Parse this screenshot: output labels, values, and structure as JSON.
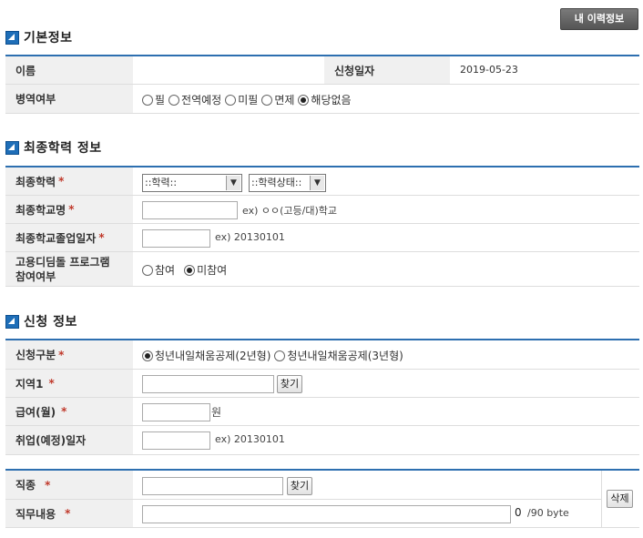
{
  "header": {
    "my_resume_button": "내 이력정보"
  },
  "sections": {
    "basic": {
      "title": "기본정보",
      "name_label": "이름",
      "name_value": "",
      "date_label": "신청일자",
      "date_value": "2019-05-23",
      "military_label": "병역여부",
      "military_options": [
        "필",
        "전역예정",
        "미필",
        "면제",
        "해당없음"
      ],
      "military_selected": "해당없음"
    },
    "education": {
      "title": "최종학력 정보",
      "degree_label": "최종학력",
      "degree_select": "::학력::",
      "status_select": "::학력상태::",
      "school_label": "최종학교명",
      "school_hint": "ex) ㅇㅇ(고등/대)학교",
      "grad_label": "최종학교졸업일자",
      "grad_hint": "ex) 20130101",
      "program_label_1": "고용디딤돌 프로그램",
      "program_label_2": "참여여부",
      "program_options": [
        "참여",
        "미참여"
      ],
      "program_selected": "미참여"
    },
    "application": {
      "title": "신청 정보",
      "type_label": "신청구분",
      "type_options": [
        "청년내일채움공제(2년형)",
        "청년내일채움공제(3년형)"
      ],
      "type_selected": "청년내일채움공제(2년형)",
      "region_label": "지역1",
      "find_button": "찾기",
      "salary_label": "급여(월)",
      "salary_unit": "원",
      "start_label": "취업(예정)일자",
      "start_hint": "ex) 20130101"
    },
    "job": {
      "job_label": "직종",
      "find_button": "찾기",
      "desc_label": "직무내용",
      "byte_count": "0",
      "byte_limit": "/90 byte",
      "delete_button": "삭제"
    }
  },
  "required_mark": "*",
  "colors": {
    "accent": "#2d6fb0",
    "required": "#c0392b",
    "header_bg": "#f0f0f0"
  }
}
